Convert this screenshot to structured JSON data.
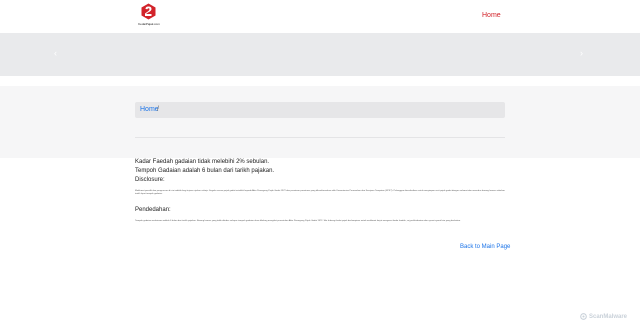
{
  "header": {
    "logo_text": "KedaiPajak.com",
    "nav_home": "Home"
  },
  "carousel": {
    "prev_icon": "chevron-left-icon",
    "next_icon": "chevron-right-icon"
  },
  "breadcrumb": {
    "home": "Home",
    "separator": "/"
  },
  "content": {
    "line1": "Kadar Faedah gadaian tidak melebihi 2% sebulan.",
    "line2": "Tempoh Gadaian adalah 6 bulan dari tarikh pajakan.",
    "disclosure_label": "Disclosure:",
    "disclosure_text": "Maklumat pemilik dan pengurusan di sini adalah bagi tujuan rujukan sahaja. Segala urusan pajak gadai tertakluk kepada Akta Pemegang Pajak Gadai 1972 dan peraturan-peraturan yang dikuatkuasakan oleh Kementerian Perumahan dan Kerajaan Tempatan (KPKT). Pelanggan dinasihatkan untuk menyimpan resit pajak gadai dengan selamat dan menebus barang kemas sebelum tarikh luput tempoh gadaian.",
    "pendedahan_label": "Pendedahan:",
    "pendedahan_text": "Tempoh gadaian maksimum adalah 6 bulan dari tarikh pajakan. Barang kemas yang tidak ditebus selepas tempoh gadaian akan dilelong mengikut peruntukan Akta Pemegang Pajak Gadai 1972. Sila hubungi kedai pajak berhampiran untuk maklumat lanjut mengenai kadar faedah, caj perkhidmatan dan syarat-syarat lain yang berkaitan."
  },
  "back_link": "Back to Main Page",
  "watermark": "ScanMalware",
  "colors": {
    "brand_red": "#d2232a",
    "link_blue": "#1a73e8"
  }
}
